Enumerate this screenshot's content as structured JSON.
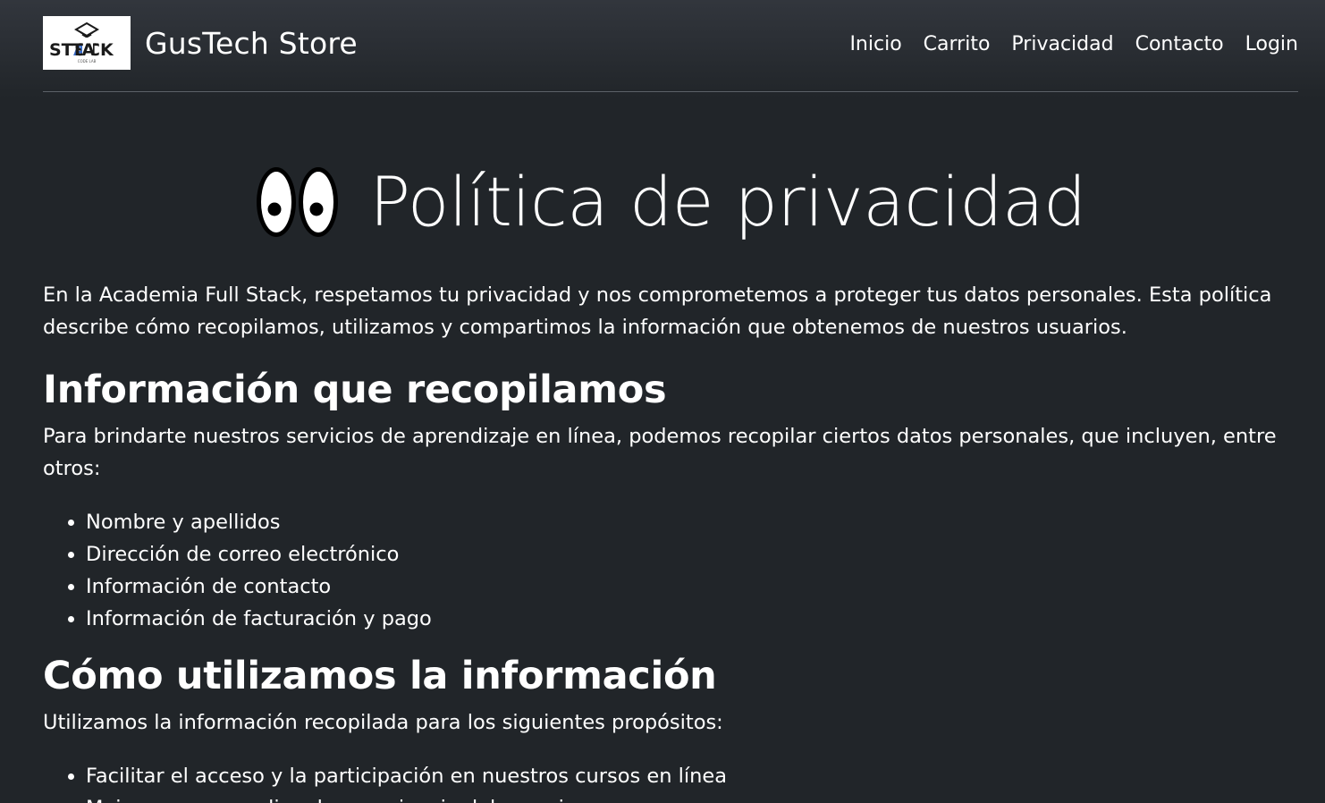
{
  "header": {
    "logo_text": "STACK",
    "brand_name": "GusTech Store",
    "nav": [
      "Inicio",
      "Carrito",
      "Privacidad",
      "Contacto",
      "Login"
    ]
  },
  "hero": {
    "emoji_icon": "eyes-icon",
    "title": "Política de privacidad"
  },
  "intro": "En la Academia Full Stack, respetamos tu privacidad y nos comprometemos a proteger tus datos personales. Esta política describe cómo recopilamos, utilizamos y compartimos la información que obtenemos de nuestros usuarios.",
  "sections": [
    {
      "heading": "Información que recopilamos",
      "text": "Para brindarte nuestros servicios de aprendizaje en línea, podemos recopilar ciertos datos personales, que incluyen, entre otros:",
      "items": [
        "Nombre y apellidos",
        "Dirección de correo electrónico",
        "Información de contacto",
        "Información de facturación y pago"
      ]
    },
    {
      "heading": "Cómo utilizamos la información",
      "text": "Utilizamos la información recopilada para los siguientes propósitos:",
      "items": [
        "Facilitar el acceso y la participación en nuestros cursos en línea",
        "Mejorar y personalizar la experiencia del usuario"
      ]
    }
  ],
  "colors": {
    "background": "#212529",
    "text": "#ffffff",
    "divider": "#5c6168"
  }
}
